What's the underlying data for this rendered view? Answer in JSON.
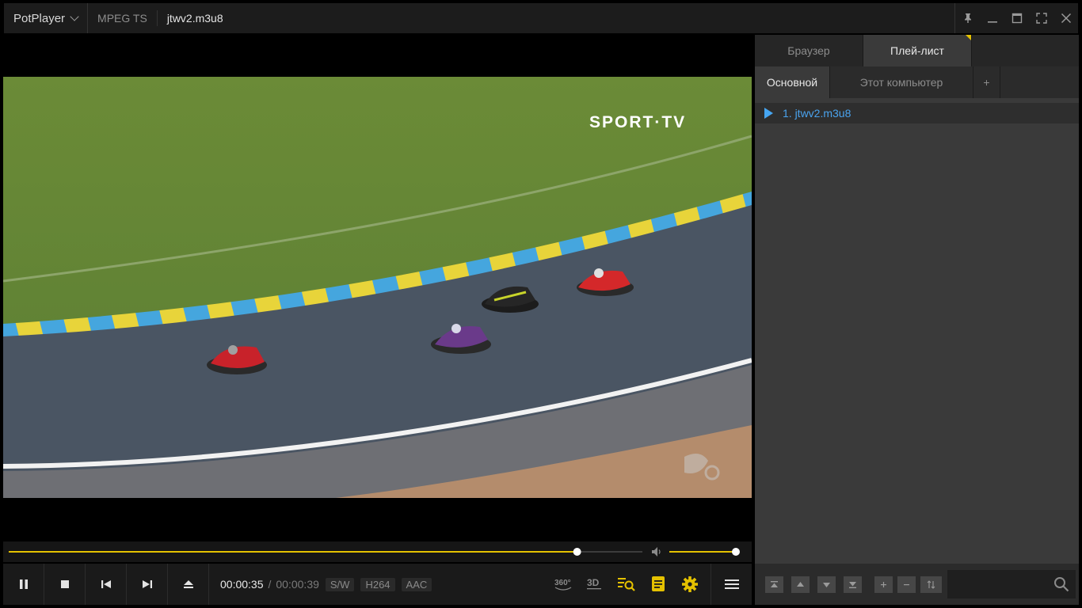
{
  "titlebar": {
    "app_name": "PotPlayer",
    "format": "MPEG TS",
    "file_title": "jtwv2.m3u8"
  },
  "video": {
    "channel_logo": "SPORT·TV"
  },
  "seek": {
    "progress_fraction": 0.897,
    "volume_fraction": 1.0
  },
  "controls": {
    "current_time": "00:00:35",
    "separator": "/",
    "total_time": "00:00:39",
    "badges": [
      "S/W",
      "H264",
      "AAC"
    ],
    "icon_360_label": "360°",
    "icon_3d_label": "3D"
  },
  "panel": {
    "tabs": [
      "Браузер",
      "Плей-лист"
    ],
    "active_tab": "Плей-лист",
    "subtabs": [
      "Основной",
      "Этот компьютер",
      "+"
    ],
    "playlist": [
      {
        "label": "1. jtwv2.m3u8",
        "playing": true
      }
    ]
  },
  "colors": {
    "accent": "#e4c100",
    "playlist_link": "#46a6f2"
  }
}
